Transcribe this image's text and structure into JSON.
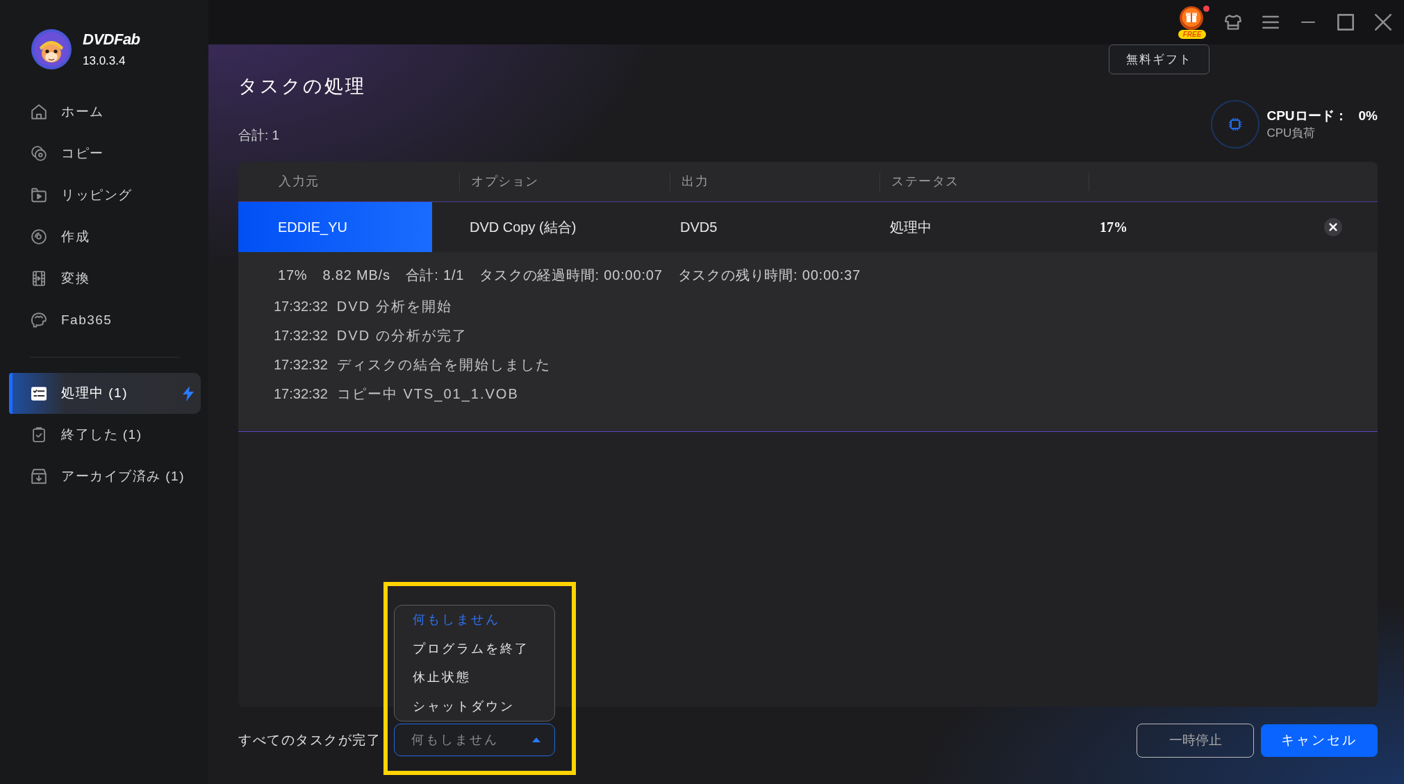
{
  "app": {
    "name": "DVDFab",
    "version": "13.0.3.4"
  },
  "sidebar": {
    "items": [
      {
        "kind": "home",
        "label": "ホーム",
        "selected": false
      },
      {
        "kind": "copy",
        "label": "コピー",
        "selected": false
      },
      {
        "kind": "ripper",
        "label": "リッピング",
        "selected": false
      },
      {
        "kind": "creator",
        "label": "作成",
        "selected": false
      },
      {
        "kind": "converter",
        "label": "変換",
        "selected": false
      },
      {
        "kind": "fab365",
        "label": "Fab365",
        "selected": false
      }
    ],
    "queue": [
      {
        "kind": "processing",
        "label": "処理中 (1)",
        "selected": true,
        "busy": true
      },
      {
        "kind": "finished",
        "label": "終了した (1)",
        "selected": false,
        "busy": false
      },
      {
        "kind": "archived",
        "label": "アーカイブ済み (1)",
        "selected": false,
        "busy": false
      }
    ]
  },
  "title_bar": {
    "free_badge": "FREE",
    "notification": true,
    "gift_tooltip": "無料ギフト"
  },
  "page": {
    "title": "タスクの処理",
    "total": "合計: 1"
  },
  "cpu": {
    "label": "CPUロード：",
    "value": "0%",
    "caption": "CPU負荷"
  },
  "table": {
    "columns": [
      "入力元",
      "オプション",
      "出力",
      "ステータス"
    ],
    "rows": [
      {
        "cells": [
          "EDDIE_YU",
          "DVD Copy (結合)",
          "DVD5",
          "処理中",
          "17%"
        ],
        "level": 0.17,
        "expanded": true,
        "details": {
          "summary": [
            "17%",
            "8.82 MB/s",
            "合計: 1/1",
            "タスクの経過時間: 00:00:07",
            "タスクの残り時間: 00:00:37"
          ],
          "log": [
            {
              "time": "17:32:32",
              "message": "DVD 分析を開始"
            },
            {
              "time": "17:32:32",
              "message": "DVD の分析が完了"
            },
            {
              "time": "17:32:32",
              "message": "ディスクの結合を開始しました"
            },
            {
              "time": "17:32:32",
              "message": "コピー中 VTS_01_1.VOB"
            }
          ]
        }
      }
    ]
  },
  "completion": {
    "label": "すべてのタスクが完了",
    "value": "何もしません",
    "expanded": true,
    "highlighted": true,
    "options": [
      {
        "label": "何もしません",
        "selected": true
      },
      {
        "label": "プログラムを終了",
        "selected": false
      },
      {
        "label": "休止状態",
        "selected": false
      },
      {
        "label": "シャットダウン",
        "selected": false
      }
    ]
  },
  "buttons": [
    {
      "kind": "secondary",
      "label": "一時停止"
    },
    {
      "kind": "primary",
      "label": "キャンセル"
    }
  ]
}
